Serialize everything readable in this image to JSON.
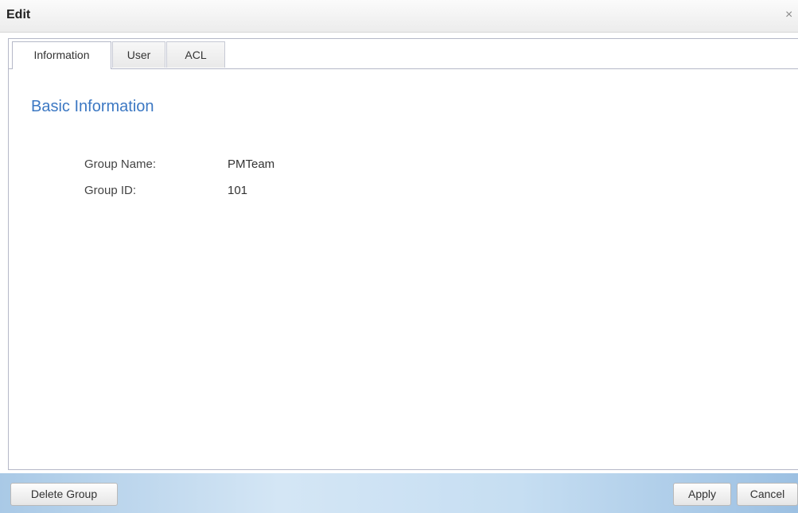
{
  "dialog": {
    "title": "Edit",
    "close_glyph": "×"
  },
  "tabs": [
    {
      "label": "Information",
      "active": true
    },
    {
      "label": "User",
      "active": false
    },
    {
      "label": "ACL",
      "active": false
    }
  ],
  "basic_info": {
    "heading": "Basic Information",
    "fields": [
      {
        "label": "Group Name:",
        "value": "PMTeam"
      },
      {
        "label": "Group ID:",
        "value": "101"
      }
    ]
  },
  "footer": {
    "delete_label": "Delete Group",
    "apply_label": "Apply",
    "cancel_label": "Cancel"
  },
  "colors": {
    "heading_accent": "#3c78c3",
    "footer_gradient_start": "#a9c9e6",
    "footer_gradient_end": "#9cc0e2"
  },
  "icons": {
    "close": "close-icon"
  }
}
